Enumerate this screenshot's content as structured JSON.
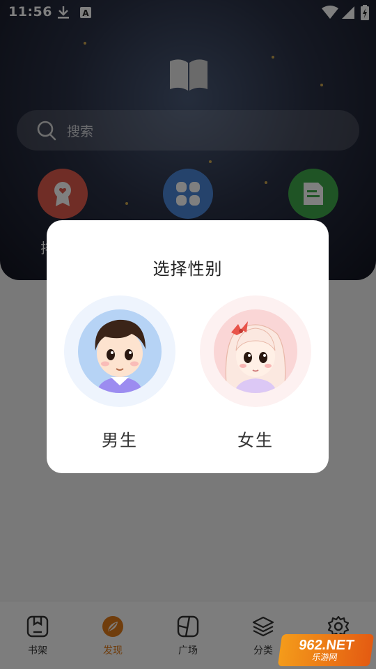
{
  "status_bar": {
    "time": "11:56",
    "icons": [
      "download-icon",
      "a-notification-icon",
      "wifi-icon",
      "signal-icon",
      "battery-icon"
    ]
  },
  "search": {
    "placeholder": "搜索"
  },
  "quick_icons": [
    "badge-icon",
    "grid-icon",
    "document-icon"
  ],
  "quick_label_fragment": "排",
  "dialog": {
    "title": "选择性别",
    "options": [
      {
        "label": "男生",
        "icon": "boy-avatar-icon",
        "ring_color": "#eef4fd",
        "bg_color": "#b6d3f5"
      },
      {
        "label": "女生",
        "icon": "girl-avatar-icon",
        "ring_color": "#fdf1f1",
        "bg_color": "#fad6d6"
      }
    ]
  },
  "tabbar": {
    "items": [
      {
        "label": "书架",
        "icon": "bookshelf-icon"
      },
      {
        "label": "发现",
        "icon": "discover-icon",
        "active": true
      },
      {
        "label": "广场",
        "icon": "square-icon"
      },
      {
        "label": "分类",
        "icon": "layers-icon"
      },
      {
        "label": "",
        "icon": "settings-icon"
      }
    ]
  },
  "watermark": {
    "line1": "962.NET",
    "line2": "乐游网"
  },
  "colors": {
    "accent": "#e07a18",
    "overlay": "rgba(0,0,0,0.5)"
  }
}
